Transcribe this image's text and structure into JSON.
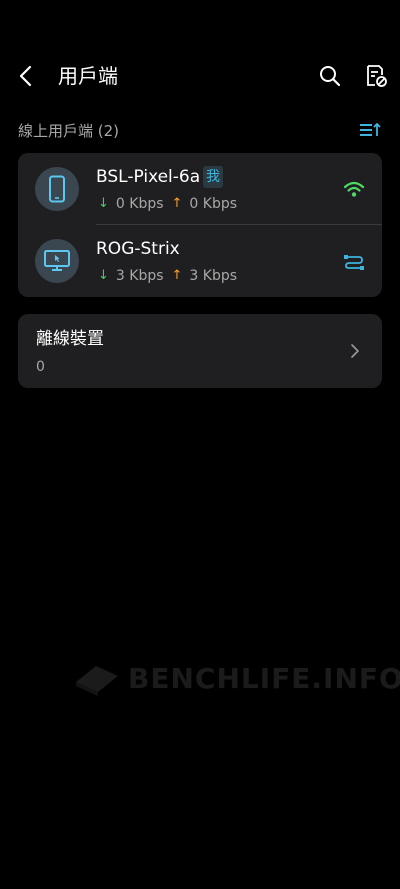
{
  "header": {
    "title": "用戶端"
  },
  "online_section": {
    "title": "線上用戶端 (2)"
  },
  "devices": [
    {
      "name": "BSL-Pixel-6a",
      "badge": "我",
      "download": "0 Kbps",
      "upload": "0 Kbps",
      "icon": "smartphone-icon",
      "connection": "wifi-icon"
    },
    {
      "name": "ROG-Strix",
      "download": "3 Kbps",
      "upload": "3 Kbps",
      "icon": "monitor-icon",
      "connection": "ethernet-icon"
    }
  ],
  "offline_section": {
    "title": "離線裝置",
    "count": "0"
  },
  "watermark": {
    "text": "BENCHLIFE.INFO"
  },
  "colors": {
    "background": "#000000",
    "card": "#1f1f21",
    "accent_blue": "#3fb4de",
    "download_green": "#4cc96b",
    "upload_orange": "#ff9f2a",
    "wifi_green": "#4cd964"
  }
}
